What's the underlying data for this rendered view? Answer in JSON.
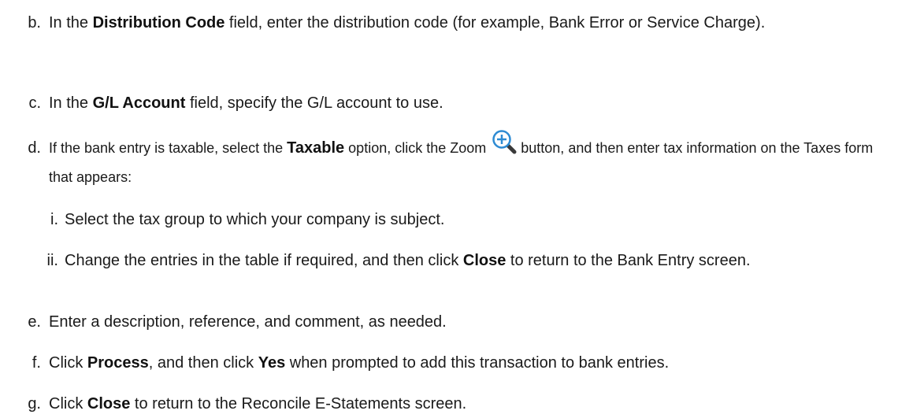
{
  "steps": [
    {
      "marker": "b.",
      "pre": "In the ",
      "bold": "Distribution Code",
      "post": " field, enter the distribution code (for example, Bank Error or Service Charge)."
    },
    {
      "marker": "c.",
      "pre": "In the ",
      "bold": "G/L Account",
      "post": " field, specify the G/L account to use."
    },
    {
      "marker": "d.",
      "pre": "If the bank entry is taxable, select the ",
      "bold": "Taxable",
      "mid": " option, click the Zoom ",
      "post": " button, and then enter tax information on the Taxes form that appears:"
    },
    {
      "marker": "e.",
      "text": "Enter a description, reference, and comment, as needed."
    },
    {
      "marker": "f.",
      "pre": "Click ",
      "bold": "Process",
      "mid": ", and then click ",
      "bold2": "Yes",
      "post": " when prompted to add this transaction to bank entries."
    },
    {
      "marker": "g.",
      "pre": "Click ",
      "bold": "Close",
      "post": " to return to the Reconcile E-Statements screen."
    }
  ],
  "substeps": [
    {
      "marker": "i.",
      "text": "Select the tax group to which your company is subject."
    },
    {
      "marker": "ii.",
      "pre": "Change the entries in the table if required, and then click ",
      "bold": "Close",
      "post": " to return to the Bank Entry screen."
    }
  ],
  "icons": {
    "zoom": "zoom-plus-icon"
  },
  "colors": {
    "zoom_ring": "#2e8bd3",
    "zoom_handle": "#3a3a3a"
  }
}
